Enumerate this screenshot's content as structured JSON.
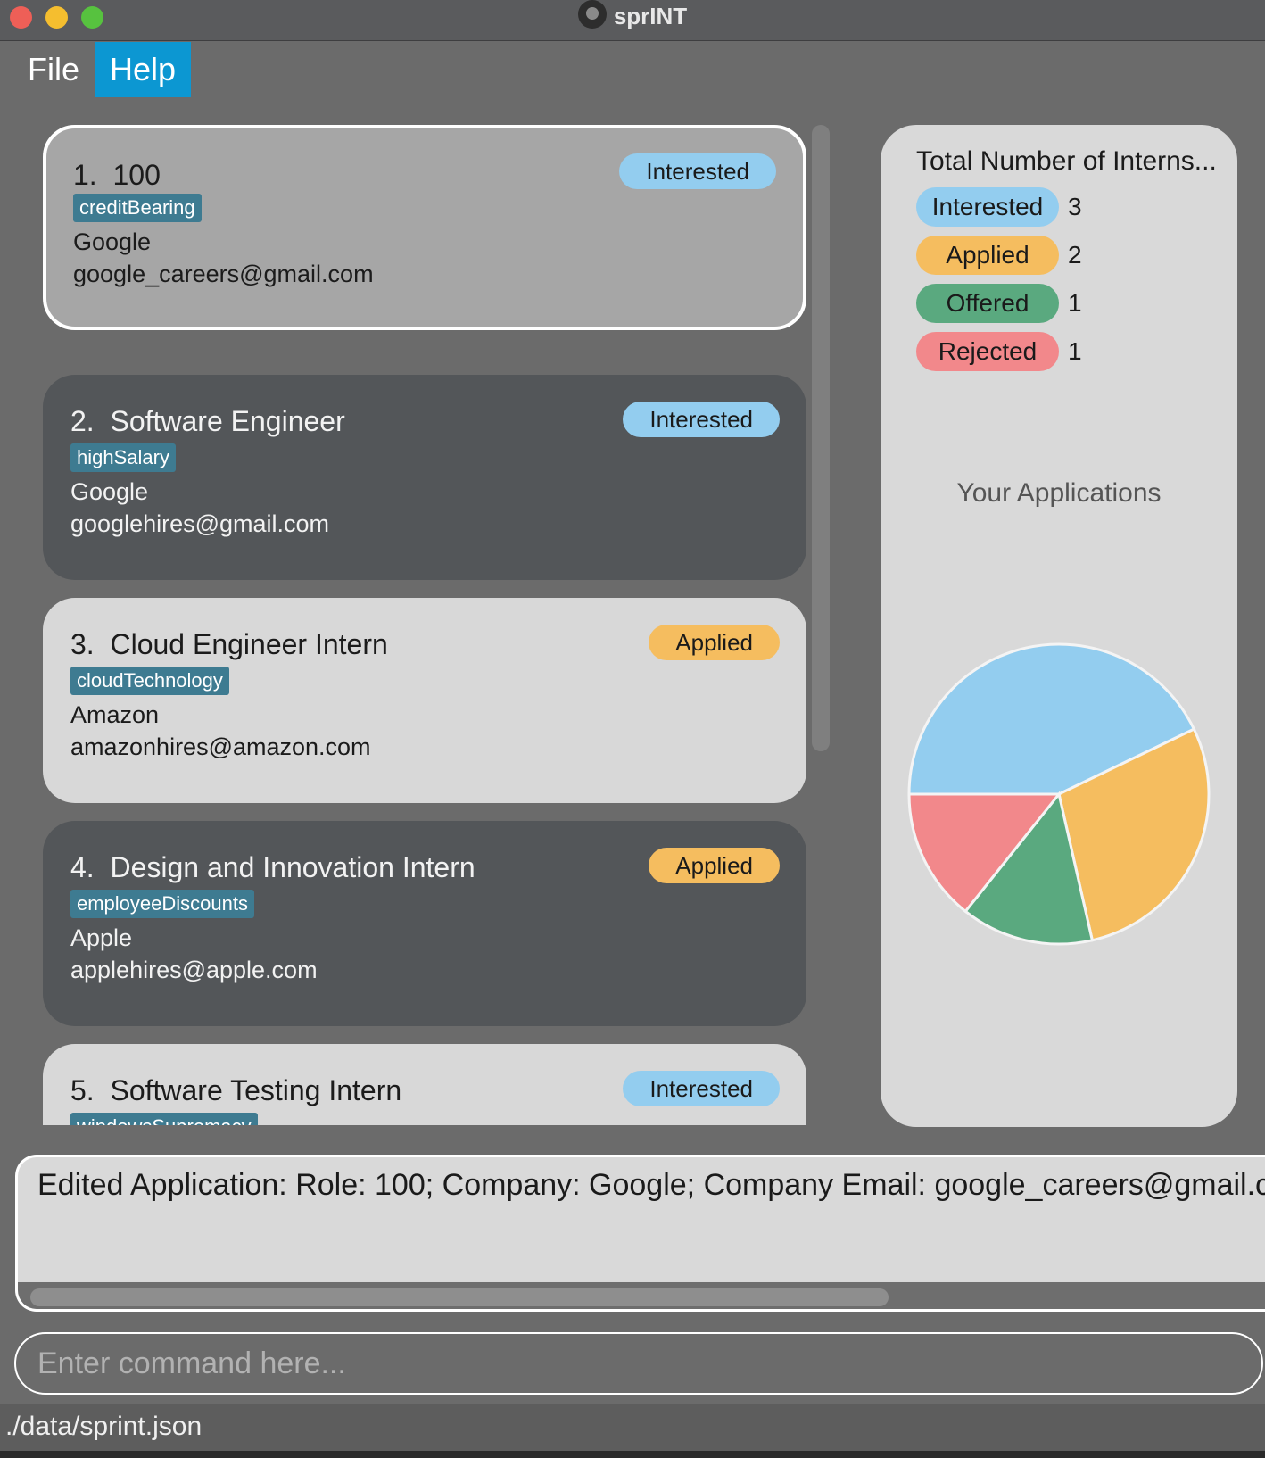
{
  "window": {
    "title": "sprINT"
  },
  "menu": {
    "file": "File",
    "help": "Help"
  },
  "applications": [
    {
      "index": "1.",
      "role": "100",
      "tag": "creditBearing",
      "company": "Google",
      "email": "google_careers@gmail.com",
      "status": "Interested",
      "style": "selected"
    },
    {
      "index": "2.",
      "role": "Software Engineer",
      "tag": "highSalary",
      "company": "Google",
      "email": "googlehires@gmail.com",
      "status": "Interested",
      "style": "dark"
    },
    {
      "index": "3.",
      "role": "Cloud Engineer Intern",
      "tag": "cloudTechnology",
      "company": "Amazon",
      "email": "amazonhires@amazon.com",
      "status": "Applied",
      "style": "light"
    },
    {
      "index": "4.",
      "role": "Design and Innovation Intern",
      "tag": "employeeDiscounts",
      "company": "Apple",
      "email": "applehires@apple.com",
      "status": "Applied",
      "style": "dark"
    },
    {
      "index": "5.",
      "role": "Software Testing Intern",
      "tag": "windowsSupremacy",
      "company": "",
      "email": "",
      "status": "Interested",
      "style": "light"
    }
  ],
  "stats": {
    "title": "Total Number of Interns...",
    "rows": [
      {
        "label": "Interested",
        "count": "3"
      },
      {
        "label": "Applied",
        "count": "2"
      },
      {
        "label": "Offered",
        "count": "1"
      },
      {
        "label": "Rejected",
        "count": "1"
      }
    ],
    "chart_title": "Your Applications"
  },
  "chart_data": {
    "type": "pie",
    "title": "Your Applications",
    "categories": [
      "Interested",
      "Applied",
      "Offered",
      "Rejected"
    ],
    "values": [
      3,
      2,
      1,
      1
    ]
  },
  "colors": {
    "Interested": "#93cdef",
    "Applied": "#f5bd5f",
    "Offered": "#5aa97f",
    "Rejected": "#f2888b",
    "menu_active": "#0c97d2",
    "tag": "#3e7b91"
  },
  "result": {
    "text": "Edited Application: Role: 100; Company: Google; Company Email: google_careers@gmail.com; Status: Interested; Tags: [creditBearing]"
  },
  "command": {
    "placeholder": "Enter command here..."
  },
  "status_bar": {
    "path": "./data/sprint.json"
  }
}
